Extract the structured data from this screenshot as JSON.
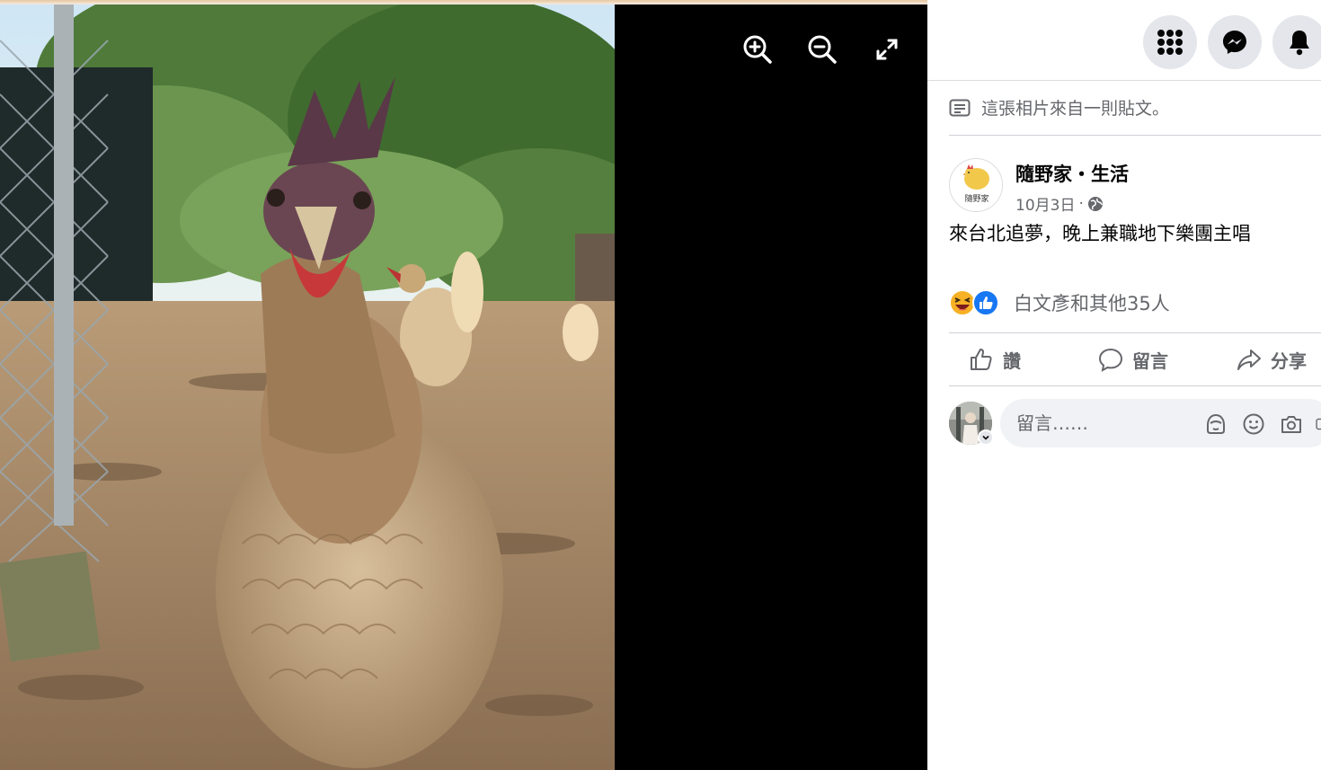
{
  "viewer": {
    "zoom_in": "zoom-in",
    "zoom_out": "zoom-out",
    "fullscreen": "fullscreen"
  },
  "topbar": {
    "menu_icon": "grid-menu-icon",
    "messenger_icon": "messenger-icon",
    "notifications_icon": "bell-icon"
  },
  "post": {
    "origin_note": "這張相片來自一則貼文。",
    "author": "隨野家・生活",
    "date": "10月3日",
    "separator": "·",
    "audience_icon": "globe-icon",
    "text": "來台北追夢，晚上兼職地下樂團主唱",
    "avatar_caption": "隨野家"
  },
  "reactions": {
    "icons": [
      "haha-emoji",
      "like-emoji"
    ],
    "summary": "白文彥和其他35人"
  },
  "actions": {
    "like": "讚",
    "comment": "留言",
    "share": "分享"
  },
  "comment": {
    "placeholder": "留言……"
  },
  "colors": {
    "viewer_bg": "#000000",
    "panel_bg": "#ffffff",
    "muted_text": "#65676b",
    "like_blue": "#1877f2",
    "haha_yellow": "#f7b125"
  }
}
